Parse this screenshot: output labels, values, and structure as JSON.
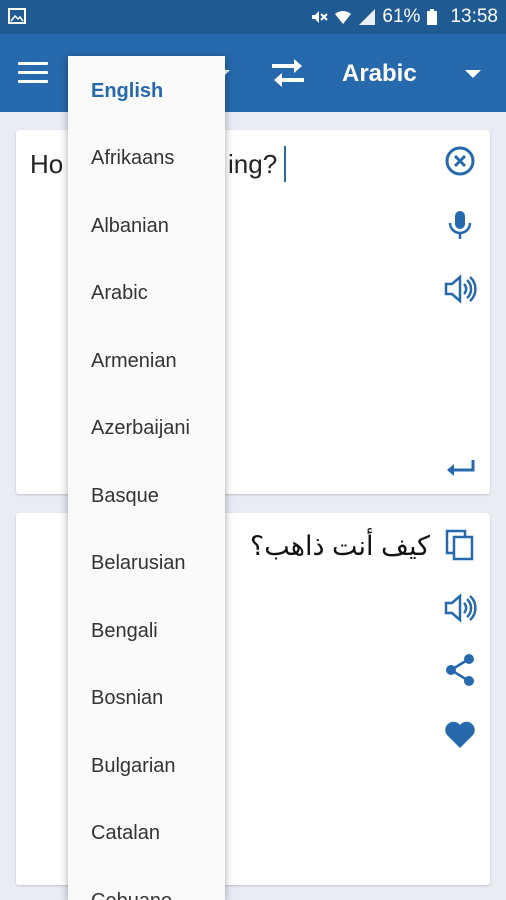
{
  "status_bar": {
    "battery": "61%",
    "time": "13:58"
  },
  "toolbar": {
    "source_language": "English",
    "target_language": "Arabic",
    "icons": [
      "menu-icon",
      "swap-icon",
      "chevron-down-icon"
    ]
  },
  "source": {
    "text_visible_start": "Ho",
    "text_visible_end": "ing?",
    "icons": [
      "clear-icon",
      "mic-icon",
      "speaker-icon",
      "enter-icon"
    ]
  },
  "translation": {
    "text": "كيف أنت ذاهب؟",
    "icons": [
      "copy-icon",
      "speaker-icon",
      "share-icon",
      "favorite-icon"
    ]
  },
  "dropdown": {
    "items": [
      "English",
      "Afrikaans",
      "Albanian",
      "Arabic",
      "Armenian",
      "Azerbaijani",
      "Basque",
      "Belarusian",
      "Bengali",
      "Bosnian",
      "Bulgarian",
      "Catalan",
      "Cebuano"
    ],
    "selected_index": 0
  },
  "colors": {
    "primary": "#2769ad",
    "status_bar": "#1f5a93",
    "background": "#e9edf3",
    "icon": "#2769ad"
  }
}
